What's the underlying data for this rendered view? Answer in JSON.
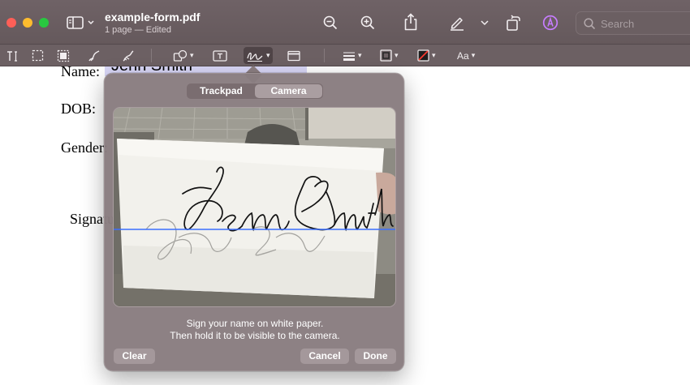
{
  "window": {
    "title": "example-form.pdf",
    "subtitle": "1 page — Edited"
  },
  "search": {
    "placeholder": "Search",
    "value": ""
  },
  "document": {
    "labels": {
      "name": "Name:",
      "dob": "DOB:",
      "gender": "Gender:",
      "signature": "Signature:"
    },
    "name_value": "Jenn Smith"
  },
  "toolbar": {
    "text_style_label": "Aa"
  },
  "signature_popover": {
    "tabs": [
      {
        "label": "Trackpad",
        "active": false
      },
      {
        "label": "Camera",
        "active": true
      }
    ],
    "instruction_line1": "Sign your name on white paper.",
    "instruction_line2": "Then hold it to be visible to the camera.",
    "clear_label": "Clear",
    "cancel_label": "Cancel",
    "done_label": "Done"
  },
  "icons": {
    "sidebar": "sidebar-icon",
    "zoom_out": "zoom-out-icon",
    "zoom_in": "zoom-in-icon",
    "share": "share-icon",
    "markup": "pen-icon",
    "rotate": "rotate-icon",
    "annotate": "annotate-circle-icon",
    "search": "search-icon"
  },
  "colors": {
    "window_chrome": "#6c6063",
    "popover_bg": "#897d80",
    "annotate_accent": "#c77dff",
    "camera_guide_line": "#3b6fff",
    "filled_field_bg": "#d8d6f6",
    "close": "#fe5f57",
    "minimize": "#febc2e",
    "zoom": "#28c840"
  }
}
